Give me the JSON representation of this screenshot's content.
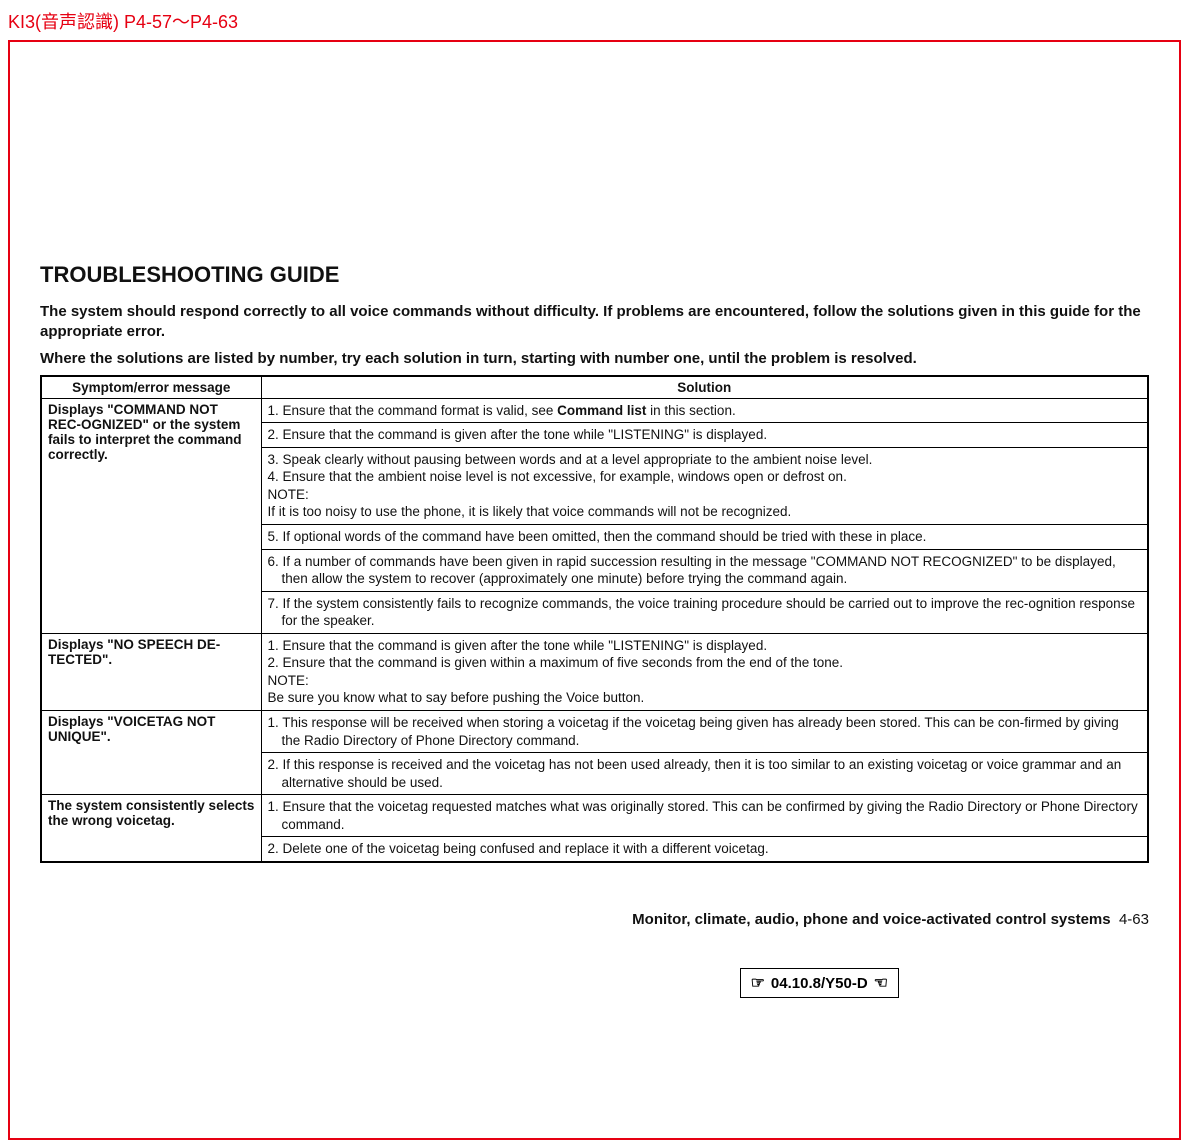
{
  "header": {
    "label": "KI3(音声認識) P4-57〜P4-63"
  },
  "content": {
    "title": "TROUBLESHOOTING GUIDE",
    "intro_line1": "The system should respond correctly to all voice commands without difficulty. If problems are encountered, follow the solutions given in this guide for the appropriate error.",
    "intro_line2": "Where the solutions are listed by number, try each solution in turn, starting with number one, until the problem is resolved."
  },
  "table": {
    "header_symptom": "Symptom/error message",
    "header_solution": "Solution",
    "rows": [
      {
        "symptom": "Displays \"COMMAND NOT REC-OGNIZED\" or the system fails to interpret the command correctly.",
        "solutions": [
          {
            "text_pre": "1. Ensure that the command format is valid, see ",
            "bold": "Command list",
            "text_post": " in this section."
          },
          {
            "text": "2. Ensure that the command is given after the tone while \"LISTENING\" is displayed."
          },
          {
            "multiline": [
              "3. Speak clearly without pausing between words and at a level appropriate to the ambient noise level.",
              "4. Ensure that the ambient noise level is not excessive, for example, windows open or defrost on.",
              "NOTE:",
              "If it is too noisy to use the phone, it is likely that voice commands will not be recognized."
            ]
          },
          {
            "text": "5. If optional words of the command have been omitted, then the command should be tried with these in place."
          },
          {
            "text_indent": "6. If a number of commands have been given in rapid succession resulting in the message \"COMMAND NOT RECOGNIZED\" to be displayed, then allow the system to recover (approximately one minute) before trying the command again."
          },
          {
            "text_indent": "7. If the system consistently fails to recognize commands, the voice training procedure should be carried out to improve the rec-ognition response for the speaker."
          }
        ]
      },
      {
        "symptom": "Displays \"NO SPEECH DE-TECTED\".",
        "solutions": [
          {
            "multiline": [
              "1. Ensure that the command is given after the tone while \"LISTENING\" is displayed.",
              "2. Ensure that the command is given within a maximum of five seconds from the end of the tone.",
              "NOTE:",
              "Be sure you know what to say before pushing the Voice button."
            ]
          }
        ]
      },
      {
        "symptom": "Displays \"VOICETAG NOT UNIQUE\".",
        "solutions": [
          {
            "text_indent": "1. This response will be received when storing a voicetag if the voicetag being given has already been stored. This can be con-firmed by giving the Radio Directory of Phone Directory command."
          },
          {
            "text_indent": "2. If this response is received and the voicetag has not been used already, then it is too similar to an existing voicetag or voice grammar and an alternative should be used."
          }
        ]
      },
      {
        "symptom": "The system consistently selects the wrong voicetag.",
        "solutions": [
          {
            "text_indent": "1. Ensure that the voicetag requested matches what was originally stored. This can be confirmed by giving the Radio Directory or Phone Directory command."
          },
          {
            "text": "2. Delete one of the voicetag being confused and replace it with a different voicetag."
          }
        ]
      }
    ]
  },
  "footer": {
    "section": "Monitor, climate, audio, phone and voice-activated control systems",
    "page": "4-63"
  },
  "datebox": {
    "text": "04.10.8/Y50-D"
  }
}
